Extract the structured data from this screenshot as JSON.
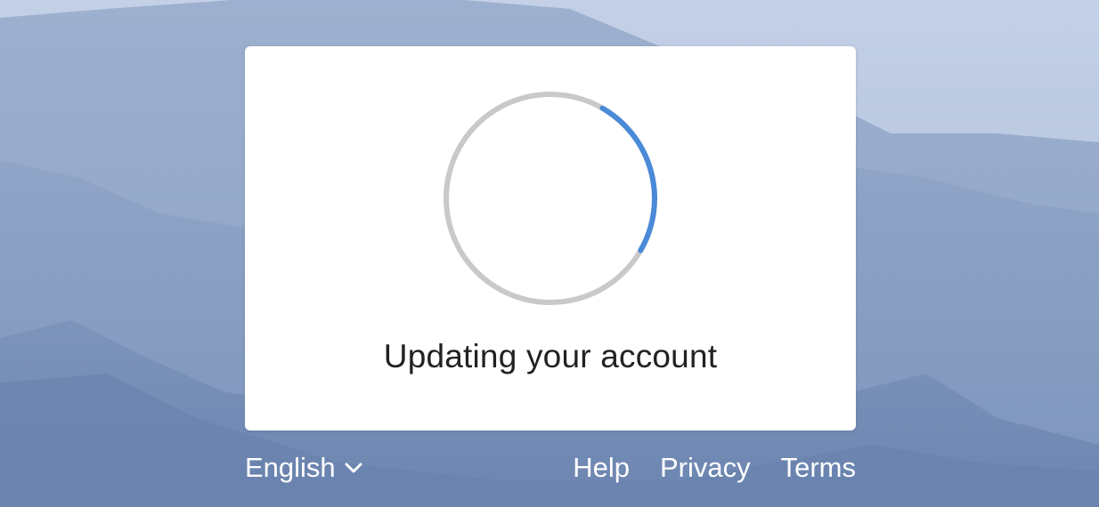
{
  "dialog": {
    "status_text": "Updating your account",
    "spinner": {
      "track_color": "#c9c9c9",
      "accent_color": "#4a8ad8"
    }
  },
  "footer": {
    "language_label": "English",
    "links": {
      "help": "Help",
      "privacy": "Privacy",
      "terms": "Terms"
    }
  },
  "icons": {
    "language_dropdown": "chevron-down-icon",
    "loading": "spinner-icon"
  },
  "colors": {
    "background": "#8fa5c6",
    "card": "#ffffff",
    "footer_text": "#ffffff"
  }
}
